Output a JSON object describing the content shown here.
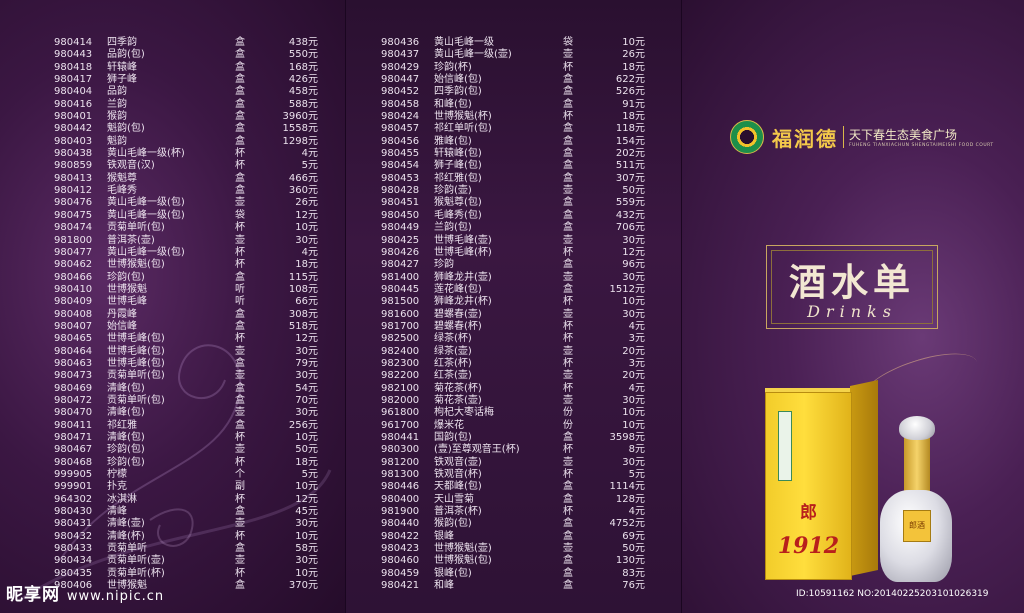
{
  "left_list": [
    [
      "980414",
      "四季韵",
      "盒",
      "438元"
    ],
    [
      "980443",
      "品韵(包)",
      "盒",
      "550元"
    ],
    [
      "980418",
      "轩辕峰",
      "盒",
      "168元"
    ],
    [
      "980417",
      "狮子峰",
      "盒",
      "426元"
    ],
    [
      "980404",
      "品韵",
      "盒",
      "458元"
    ],
    [
      "980416",
      "兰韵",
      "盒",
      "588元"
    ],
    [
      "980401",
      "猴韵",
      "盒",
      "3960元"
    ],
    [
      "980442",
      "魁韵(包)",
      "盒",
      "1558元"
    ],
    [
      "980403",
      "魁韵",
      "盒",
      "1298元"
    ],
    [
      "980438",
      "黄山毛峰一级(杯)",
      "杯",
      "4元"
    ],
    [
      "980859",
      "铁观音(汉)",
      "杯",
      "5元"
    ],
    [
      "980413",
      "猴魁尊",
      "盒",
      "466元"
    ],
    [
      "980412",
      "毛峰秀",
      "盒",
      "360元"
    ],
    [
      "980476",
      "黄山毛峰一级(包)",
      "壶",
      "26元"
    ],
    [
      "980475",
      "黄山毛峰一级(包)",
      "袋",
      "12元"
    ],
    [
      "980474",
      "贡菊单听(包)",
      "杯",
      "10元"
    ],
    [
      "981800",
      "普洱茶(壶)",
      "壶",
      "30元"
    ],
    [
      "980477",
      "黄山毛峰一级(包)",
      "杯",
      "4元"
    ],
    [
      "980462",
      "世博猴魁(包)",
      "杯",
      "18元"
    ],
    [
      "980466",
      "珍韵(包)",
      "盒",
      "115元"
    ],
    [
      "980410",
      "世博猴魁",
      "听",
      "108元"
    ],
    [
      "980409",
      "世博毛峰",
      "听",
      "66元"
    ],
    [
      "980408",
      "丹霞峰",
      "盒",
      "308元"
    ],
    [
      "980407",
      "始信峰",
      "盒",
      "518元"
    ],
    [
      "980465",
      "世博毛峰(包)",
      "杯",
      "12元"
    ],
    [
      "980464",
      "世博毛峰(包)",
      "壶",
      "30元"
    ],
    [
      "980463",
      "世博毛峰(包)",
      "盒",
      "79元"
    ],
    [
      "980473",
      "贡菊单听(包)",
      "壶",
      "30元"
    ],
    [
      "980469",
      "清峰(包)",
      "盒",
      "54元"
    ],
    [
      "980472",
      "贡菊单听(包)",
      "盒",
      "70元"
    ],
    [
      "980470",
      "清峰(包)",
      "壶",
      "30元"
    ],
    [
      "980411",
      "祁红雅",
      "盒",
      "256元"
    ],
    [
      "980471",
      "清峰(包)",
      "杯",
      "10元"
    ],
    [
      "980467",
      "珍韵(包)",
      "壶",
      "50元"
    ],
    [
      "980468",
      "珍韵(包)",
      "杯",
      "18元"
    ],
    [
      "999905",
      "柠檬",
      "个",
      "5元"
    ],
    [
      "999901",
      "扑克",
      "副",
      "10元"
    ],
    [
      "964302",
      "冰淇淋",
      "杯",
      "12元"
    ],
    [
      "980430",
      "清峰",
      "盒",
      "45元"
    ],
    [
      "980431",
      "清峰(壶)",
      "壶",
      "30元"
    ],
    [
      "980432",
      "清峰(杯)",
      "杯",
      "10元"
    ],
    [
      "980433",
      "贡菊单听",
      "盒",
      "58元"
    ],
    [
      "980434",
      "贡菊单听(壶)",
      "壶",
      "30元"
    ],
    [
      "980435",
      "贡菊单听(杯)",
      "杯",
      "10元"
    ],
    [
      "980406",
      "世博猴魁",
      "盒",
      "370元"
    ]
  ],
  "right_list": [
    [
      "980436",
      "黄山毛峰一级",
      "袋",
      "10元"
    ],
    [
      "980437",
      "黄山毛峰一级(壶)",
      "壶",
      "26元"
    ],
    [
      "980429",
      "珍韵(杯)",
      "杯",
      "18元"
    ],
    [
      "980447",
      "始信峰(包)",
      "盒",
      "622元"
    ],
    [
      "980452",
      "四季韵(包)",
      "盒",
      "526元"
    ],
    [
      "980458",
      "和峰(包)",
      "盒",
      "91元"
    ],
    [
      "980424",
      "世博猴魁(杯)",
      "杯",
      "18元"
    ],
    [
      "980457",
      "祁红单听(包)",
      "盒",
      "118元"
    ],
    [
      "980456",
      "雅峰(包)",
      "盒",
      "154元"
    ],
    [
      "980455",
      "轩辕峰(包)",
      "盒",
      "202元"
    ],
    [
      "980454",
      "狮子峰(包)",
      "盒",
      "511元"
    ],
    [
      "980453",
      "祁红雅(包)",
      "盒",
      "307元"
    ],
    [
      "980428",
      "珍韵(壶)",
      "壶",
      "50元"
    ],
    [
      "980451",
      "猴魁尊(包)",
      "盒",
      "559元"
    ],
    [
      "980450",
      "毛峰秀(包)",
      "盒",
      "432元"
    ],
    [
      "980449",
      "兰韵(包)",
      "盒",
      "706元"
    ],
    [
      "980425",
      "世博毛峰(壶)",
      "壶",
      "30元"
    ],
    [
      "980426",
      "世博毛峰(杯)",
      "杯",
      "12元"
    ],
    [
      "980427",
      "珍韵",
      "盒",
      "96元"
    ],
    [
      "981400",
      "狮峰龙井(壶)",
      "壶",
      "30元"
    ],
    [
      "980445",
      "莲花峰(包)",
      "盒",
      "1512元"
    ],
    [
      "981500",
      "狮峰龙井(杯)",
      "杯",
      "10元"
    ],
    [
      "981600",
      "碧螺春(壶)",
      "壶",
      "30元"
    ],
    [
      "981700",
      "碧螺春(杯)",
      "杯",
      "4元"
    ],
    [
      "982500",
      "绿茶(杯)",
      "杯",
      "3元"
    ],
    [
      "982400",
      "绿茶(壶)",
      "壶",
      "20元"
    ],
    [
      "982300",
      "红茶(杯)",
      "杯",
      "3元"
    ],
    [
      "982200",
      "红茶(壶)",
      "壶",
      "20元"
    ],
    [
      "982100",
      "菊花茶(杯)",
      "杯",
      "4元"
    ],
    [
      "982000",
      "菊花茶(壶)",
      "壶",
      "30元"
    ],
    [
      "961800",
      "枸杞大枣话梅",
      "份",
      "10元"
    ],
    [
      "961700",
      "爆米花",
      "份",
      "10元"
    ],
    [
      "980441",
      "国韵(包)",
      "盒",
      "3598元"
    ],
    [
      "980300",
      "(壹)至尊观音王(杯)",
      "杯",
      "8元"
    ],
    [
      "981200",
      "铁观音(壶)",
      "壶",
      "30元"
    ],
    [
      "981300",
      "铁观音(杯)",
      "杯",
      "5元"
    ],
    [
      "980446",
      "天都峰(包)",
      "盒",
      "1114元"
    ],
    [
      "980400",
      "天山雪菊",
      "盒",
      "128元"
    ],
    [
      "981900",
      "普洱茶(杯)",
      "杯",
      "4元"
    ],
    [
      "980440",
      "猴韵(包)",
      "盒",
      "4752元"
    ],
    [
      "980422",
      "银峰",
      "盒",
      "69元"
    ],
    [
      "980423",
      "世博猴魁(壶)",
      "壶",
      "50元"
    ],
    [
      "980460",
      "世博猴魁(包)",
      "盒",
      "130元"
    ],
    [
      "980459",
      "银峰(包)",
      "盒",
      "83元"
    ],
    [
      "980421",
      "和峰",
      "盒",
      "76元"
    ]
  ],
  "logo": {
    "brand": "福润德",
    "slogan": "天下春生态美食广场",
    "english": "FUHENG TIANXIACHUN SHENGTAIMEISHI FOOD COURT"
  },
  "title": {
    "cn": "酒水单",
    "en": "Drinks"
  },
  "product": {
    "brand": "郎",
    "year": "1912",
    "tag": "郎酒"
  },
  "watermark": {
    "left": "昵享网",
    "left_url": "www.nipic.cn",
    "right": "ID:10591162 NO:20140225203101026319"
  },
  "colors": {
    "accent": "#c8a660",
    "bg": "#3b1743",
    "text": "#ece2ee"
  }
}
